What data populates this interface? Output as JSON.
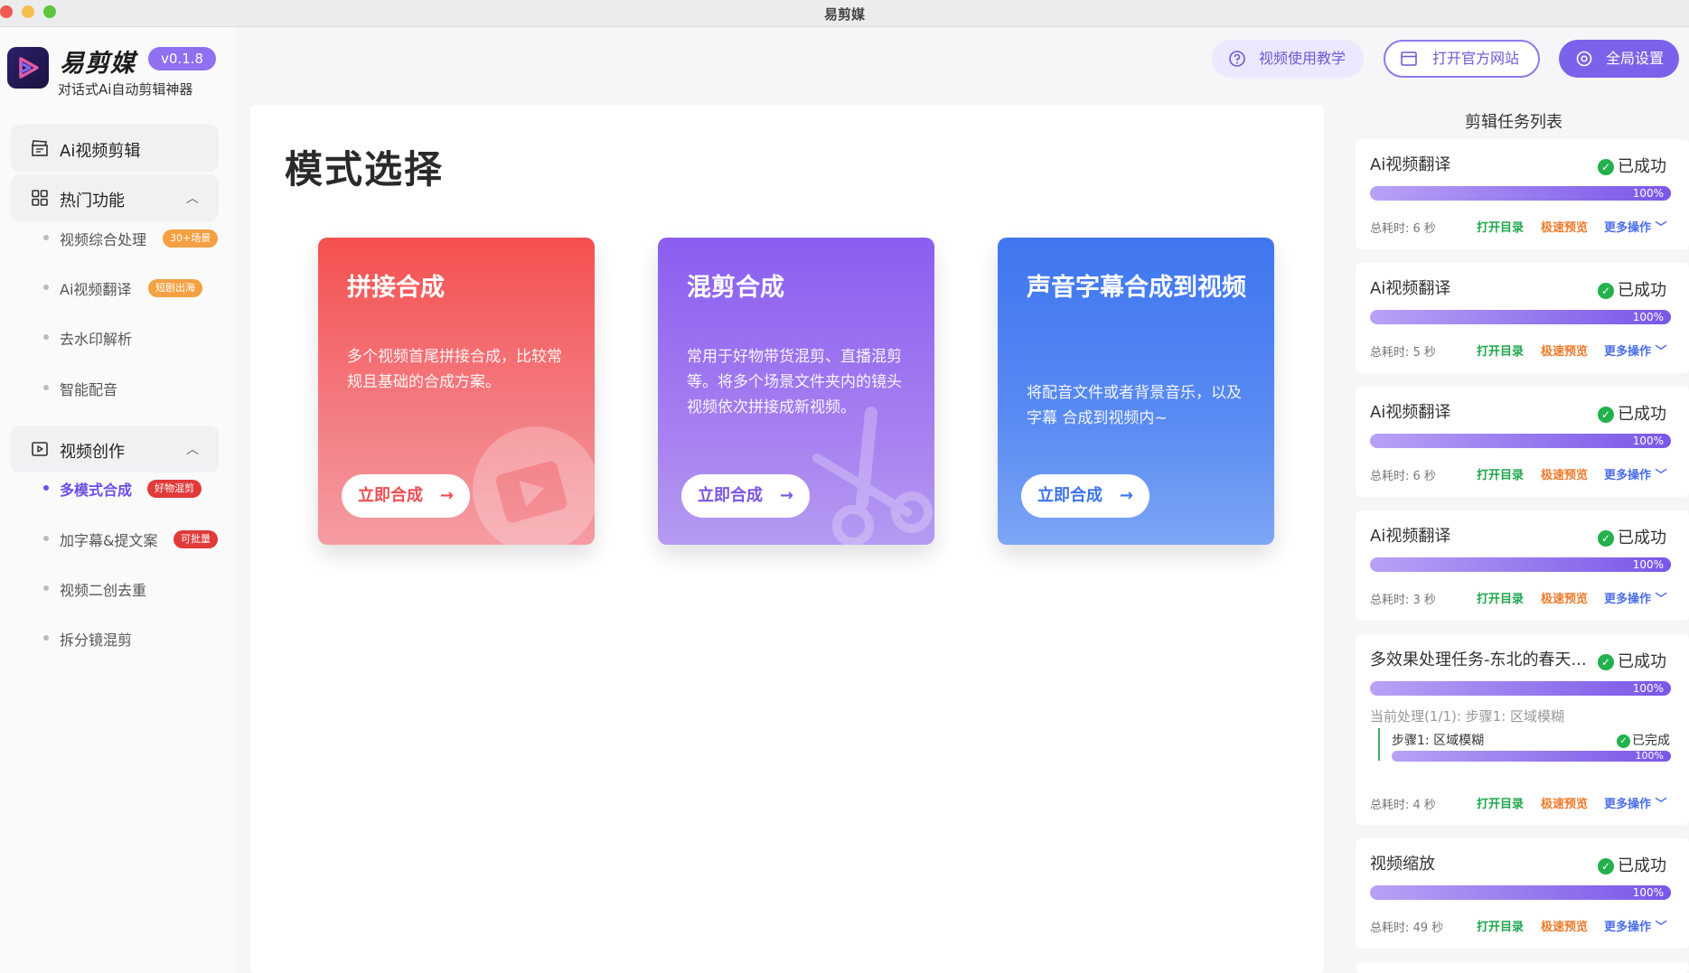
{
  "window": {
    "title": "易剪媒"
  },
  "app": {
    "name": "易剪媒",
    "version": "v0.1.8",
    "subtitle": "对话式Ai自动剪辑神器"
  },
  "header": {
    "tutorial": "视频使用教学",
    "website": "打开官方网站",
    "settings": "全局设置"
  },
  "sidebar": {
    "ai_edit": "Ai视频剪辑",
    "hot": {
      "label": "热门功能",
      "items": [
        {
          "label": "视频综合处理",
          "tag": "30+场景"
        },
        {
          "label": "Ai视频翻译",
          "tag": "短剧出海"
        },
        {
          "label": "去水印解析"
        },
        {
          "label": "智能配音"
        }
      ]
    },
    "create": {
      "label": "视频创作",
      "items": [
        {
          "label": "多模式合成",
          "tag": "好物混剪"
        },
        {
          "label": "加字幕&提文案",
          "tag": "可批量"
        },
        {
          "label": "视频二创去重"
        },
        {
          "label": "拆分镜混剪"
        }
      ]
    }
  },
  "main": {
    "title": "模式选择",
    "cards": [
      {
        "title": "拼接合成",
        "desc": "多个视频首尾拼接合成，比较常规且基础的合成方案。",
        "button": "立即合成"
      },
      {
        "title": "混剪合成",
        "desc": "常用于好物带货混剪、直播混剪等。将多个场景文件夹内的镜头视频依次拼接成新视频。",
        "button": "立即合成"
      },
      {
        "title": "声音字幕合成到视频",
        "desc": "将配音文件或者背景音乐，以及字幕 合成到视频内~",
        "button": "立即合成"
      }
    ],
    "arrow": "→"
  },
  "tasks": {
    "title": "剪辑任务列表",
    "open": "打开目录",
    "preview": "极速预览",
    "more": "更多操作",
    "items": [
      {
        "name": "Ai视频翻译",
        "status": "已成功",
        "progress": "100%",
        "time": "总耗时: 6 秒"
      },
      {
        "name": "Ai视频翻译",
        "status": "已成功",
        "progress": "100%",
        "time": "总耗时: 5 秒"
      },
      {
        "name": "Ai视频翻译",
        "status": "已成功",
        "progress": "100%",
        "time": "总耗时: 6 秒"
      },
      {
        "name": "Ai视频翻译",
        "status": "已成功",
        "progress": "100%",
        "time": "总耗时: 3 秒"
      },
      {
        "name": "多效果处理任务-东北的春天...",
        "status": "已成功",
        "progress": "100%",
        "time": "总耗时: 4 秒",
        "current": "当前处理(1/1): 步骤1:  区域模糊",
        "step": "步骤1:  区域模糊",
        "step_status": "已完成",
        "step_progress": "100%"
      },
      {
        "name": "视频缩放",
        "status": "已成功",
        "progress": "100%",
        "time": "总耗时: 49 秒"
      }
    ]
  }
}
